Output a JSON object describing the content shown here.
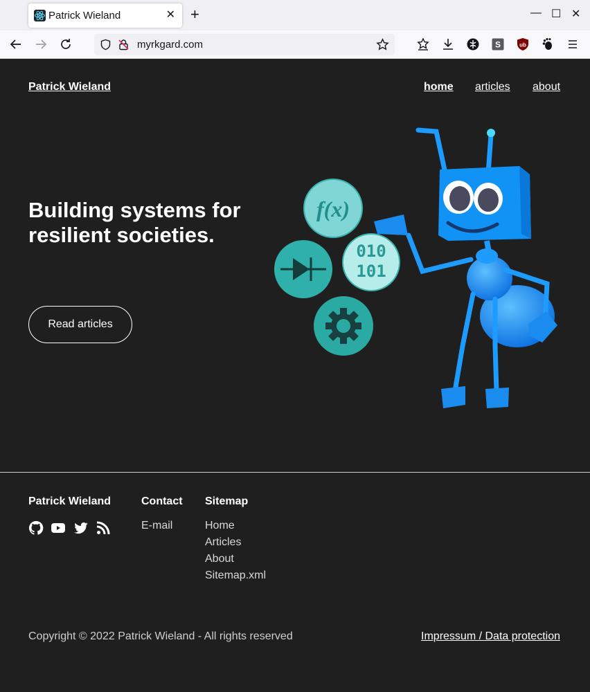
{
  "browser": {
    "tab_title": "Patrick Wieland",
    "url": "myrkgard.com"
  },
  "site": {
    "title": "Patrick Wieland",
    "nav": [
      "home",
      "articles",
      "about"
    ]
  },
  "hero": {
    "heading": "Building systems for resilient societies.",
    "cta": "Read articles",
    "illustration_text": {
      "fx": "f(x)",
      "binary_top": "010",
      "binary_bottom": "101"
    }
  },
  "footer": {
    "brand": "Patrick Wieland",
    "contact_heading": "Contact",
    "contact_links": [
      "E-mail"
    ],
    "sitemap_heading": "Sitemap",
    "sitemap_links": [
      "Home",
      "Articles",
      "About",
      "Sitemap.xml"
    ],
    "social_icons": [
      "github-icon",
      "youtube-icon",
      "twitter-icon",
      "rss-icon"
    ],
    "copyright": "Copyright © 2022 Patrick Wieland - All rights reserved",
    "legal_link": "Impressum / Data protection"
  },
  "colors": {
    "page_bg": "#1f1f1f",
    "robot_blue": "#1e9bff",
    "teal": "#35b5b0"
  }
}
